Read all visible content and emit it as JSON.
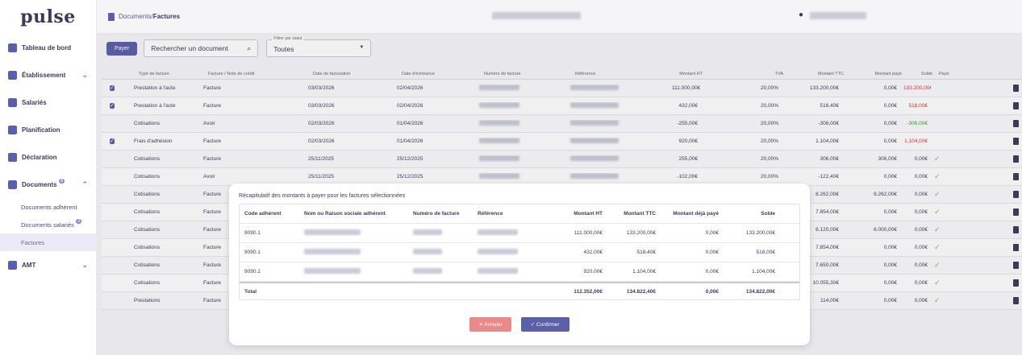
{
  "app": {
    "logo": "pulse"
  },
  "breadcrumb": {
    "section": "Documents",
    "separator": " / ",
    "current": "Factures"
  },
  "sidebar": {
    "items": [
      {
        "label": "Tableau de bord"
      },
      {
        "label": "Établissement"
      },
      {
        "label": "Salariés"
      },
      {
        "label": "Planification"
      },
      {
        "label": "Déclaration"
      },
      {
        "label": "Documents",
        "badge": "3"
      },
      {
        "label": "AMT"
      }
    ],
    "sub": [
      {
        "label": "Documents adhérent"
      },
      {
        "label": "Documents salariés",
        "badge": "3"
      },
      {
        "label": "Factures"
      }
    ]
  },
  "toolbar": {
    "pay_label": "Payer",
    "search_placeholder": "Rechercher un document",
    "filter_label": "Filtrer par statut",
    "filter_value": "Toutes"
  },
  "table": {
    "headers": [
      "Type de facture",
      "Facture / Note de crédit",
      "Date de facturation",
      "Date d'échéance",
      "Numéro de facture",
      "Référence",
      "Montant HT",
      "TVA",
      "Montant TTC",
      "Montant payé",
      "Solde",
      "Payé"
    ],
    "rows": [
      {
        "checked": true,
        "type": "Prestation à l'acte",
        "kind": "Facture",
        "date": "03/03/2026",
        "due": "02/04/2026",
        "ht": "111.000,00€",
        "tva": "20,00%",
        "ttc": "133.200,00€",
        "paid": "0,00€",
        "solde": "133.200,00€",
        "solde_color": "red",
        "payed": false
      },
      {
        "checked": true,
        "type": "Prestation à l'acte",
        "kind": "Facture",
        "date": "03/03/2026",
        "due": "02/04/2026",
        "ht": "432,00€",
        "tva": "20,00%",
        "ttc": "518,40€",
        "paid": "0,00€",
        "solde": "518,00€",
        "solde_color": "red",
        "payed": false
      },
      {
        "checked": false,
        "type": "Cotisations",
        "kind": "Avoir",
        "date": "02/03/2026",
        "due": "01/04/2026",
        "ht": "-255,00€",
        "tva": "20,00%",
        "ttc": "-306,00€",
        "paid": "0,00€",
        "solde": "-306,00€",
        "solde_color": "green",
        "payed": false
      },
      {
        "checked": true,
        "type": "Frais d'adhésion",
        "kind": "Facture",
        "date": "02/03/2026",
        "due": "01/04/2026",
        "ht": "920,00€",
        "tva": "20,00%",
        "ttc": "1.104,00€",
        "paid": "0,00€",
        "solde": "1.104,00€",
        "solde_color": "red",
        "payed": false
      },
      {
        "checked": false,
        "type": "Cotisations",
        "kind": "Facture",
        "date": "25/11/2025",
        "due": "25/12/2025",
        "ht": "255,00€",
        "tva": "20,00%",
        "ttc": "306,00€",
        "paid": "306,00€",
        "solde": "0,00€",
        "solde_color": "",
        "payed": true
      },
      {
        "checked": false,
        "type": "Cotisations",
        "kind": "Avoir",
        "date": "25/11/2025",
        "due": "25/12/2025",
        "ht": "-102,00€",
        "tva": "20,00%",
        "ttc": "-122,40€",
        "paid": "0,00€",
        "solde": "0,00€",
        "solde_color": "",
        "payed": true
      },
      {
        "checked": false,
        "type": "Cotisations",
        "kind": "Facture",
        "date": "",
        "due": "",
        "ht": "",
        "tva": "",
        "ttc": "8.262,00€",
        "paid": "8.262,00€",
        "solde": "0,00€",
        "solde_color": "",
        "payed": true
      },
      {
        "checked": false,
        "type": "Cotisations",
        "kind": "Facture",
        "date": "",
        "due": "",
        "ht": "",
        "tva": "",
        "ttc": "7.854,00€",
        "paid": "0,00€",
        "solde": "0,00€",
        "solde_color": "",
        "payed": true
      },
      {
        "checked": false,
        "type": "Cotisations",
        "kind": "Facture",
        "date": "",
        "due": "",
        "ht": "",
        "tva": "",
        "ttc": "6.120,00€",
        "paid": "6.000,00€",
        "solde": "0,00€",
        "solde_color": "",
        "payed": true
      },
      {
        "checked": false,
        "type": "Cotisations",
        "kind": "Facture",
        "date": "",
        "due": "",
        "ht": "",
        "tva": "",
        "ttc": "7.854,00€",
        "paid": "0,00€",
        "solde": "0,00€",
        "solde_color": "",
        "payed": true
      },
      {
        "checked": false,
        "type": "Cotisations",
        "kind": "Facture",
        "date": "",
        "due": "",
        "ht": "",
        "tva": "",
        "ttc": "7.650,00€",
        "paid": "0,00€",
        "solde": "0,00€",
        "solde_color": "",
        "payed": true
      },
      {
        "checked": false,
        "type": "Cotisations",
        "kind": "Facture",
        "date": "",
        "due": "",
        "ht": "",
        "tva": "",
        "ttc": "10.055,30€",
        "paid": "0,00€",
        "solde": "0,00€",
        "solde_color": "",
        "payed": true
      },
      {
        "checked": false,
        "type": "Prestations",
        "kind": "Facture",
        "date": "",
        "due": "",
        "ht": "",
        "tva": "",
        "ttc": "114,00€",
        "paid": "0,00€",
        "solde": "0,00€",
        "solde_color": "",
        "payed": true
      }
    ]
  },
  "modal": {
    "title": "Récapitulatif des montants à payer pour les factures sélectionnées",
    "headers": [
      "Code adhérent",
      "Nom ou Raison sociale adhérent",
      "Numéro de facture",
      "Référence",
      "Montant HT",
      "Montant TTC",
      "Montant déjà payé",
      "Solde"
    ],
    "rows": [
      {
        "code": "9090.1",
        "ht": "111.000,00€",
        "ttc": "133.200,00€",
        "paid": "0,00€",
        "solde": "133.200,00€"
      },
      {
        "code": "9090.1",
        "ht": "432,00€",
        "ttc": "518,40€",
        "paid": "0,00€",
        "solde": "518,00€"
      },
      {
        "code": "9090.1",
        "ht": "920,00€",
        "ttc": "1.104,00€",
        "paid": "0,00€",
        "solde": "1.104,00€"
      }
    ],
    "total": {
      "label": "Total",
      "ht": "112.352,00€",
      "ttc": "134.822,40€",
      "paid": "0,00€",
      "solde": "134.822,00€"
    },
    "cancel_label": "Annuler",
    "confirm_label": "Confirmer"
  }
}
